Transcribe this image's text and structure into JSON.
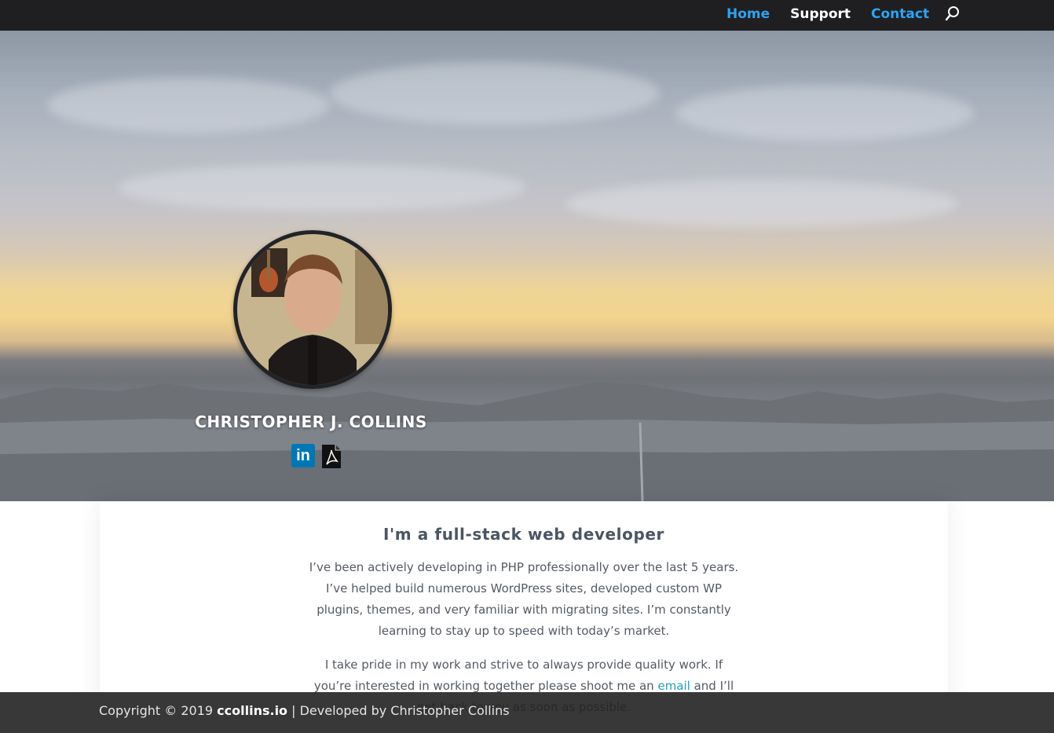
{
  "nav": {
    "items": [
      {
        "label": "Home",
        "color": "#2ea3f2"
      },
      {
        "label": "Support",
        "color": "#ffffff"
      },
      {
        "label": "Contact",
        "color": "#2ea3f2"
      }
    ],
    "search_icon": "search-icon"
  },
  "hero": {
    "name": "CHRISTOPHER J. COLLINS",
    "social": [
      {
        "label": "in",
        "icon": "linkedin-icon"
      },
      {
        "icon": "pdf-icon"
      }
    ]
  },
  "intro": {
    "heading": "I'm a full-stack web developer",
    "paragraph1": "I’ve been actively developing in PHP professionally over the last 5 years. I’ve helped build numerous WordPress sites, developed custom WP plugins, themes, and very familiar with migrating sites. I’m constantly learning to stay up to speed with today’s market.",
    "paragraph2_start": "I take pride in my work and strive to always provide quality work. If you’re interested in working together please shoot me an ",
    "paragraph2_link": "email",
    "paragraph2_end": " and I’ll get back to you as soon as possible."
  },
  "footer": {
    "prefix": "Copyright © 2019 ",
    "brand": "ccollins.io",
    "suffix": " | Developed by Christopher Collins"
  },
  "colors": {
    "accent": "#2ea3f2",
    "topbar": "#1f1f22",
    "footer": "#222222",
    "link": "#1ea1c4"
  }
}
